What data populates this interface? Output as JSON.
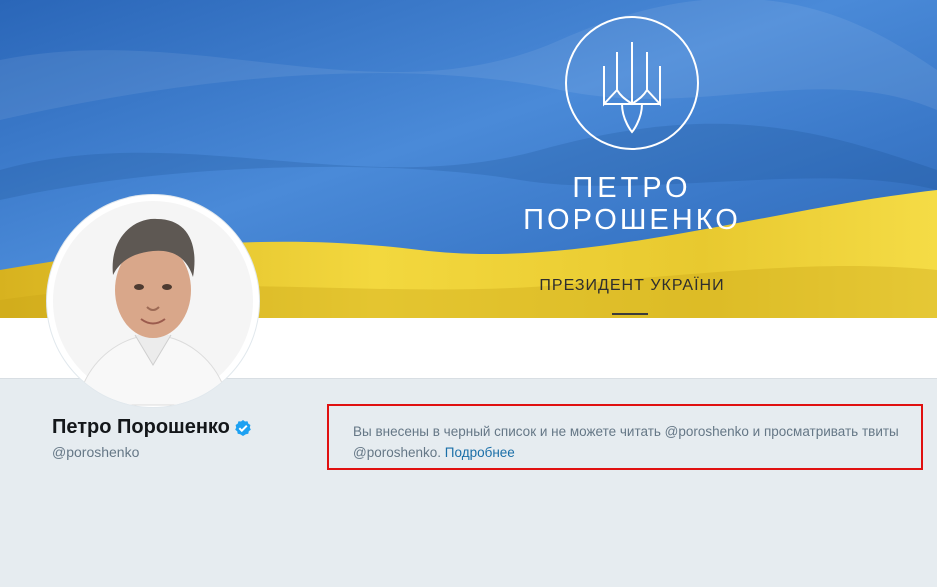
{
  "banner": {
    "name_line1": "ПЕТРО",
    "name_line2": "ПОРОШЕНКО",
    "subtitle": "ПРЕЗИДЕНТ УКРАЇНИ"
  },
  "profile": {
    "display_name": "Петро Порошенко",
    "handle": "@poroshenko",
    "verified": true
  },
  "blocked_notice": {
    "message": "Вы внесены в черный список и не можете читать @poroshenko и просматривать твиты @poroshenko.",
    "link_label": "Подробнее"
  },
  "colors": {
    "flag_blue": "#3f7fd0",
    "flag_yellow": "#f1d43a",
    "verified_blue": "#1da1f2",
    "link_blue": "#1b6fa8",
    "alert_border": "#e01010"
  },
  "icons": {
    "verified": "verified-badge-icon",
    "emblem": "trident-emblem-icon"
  }
}
